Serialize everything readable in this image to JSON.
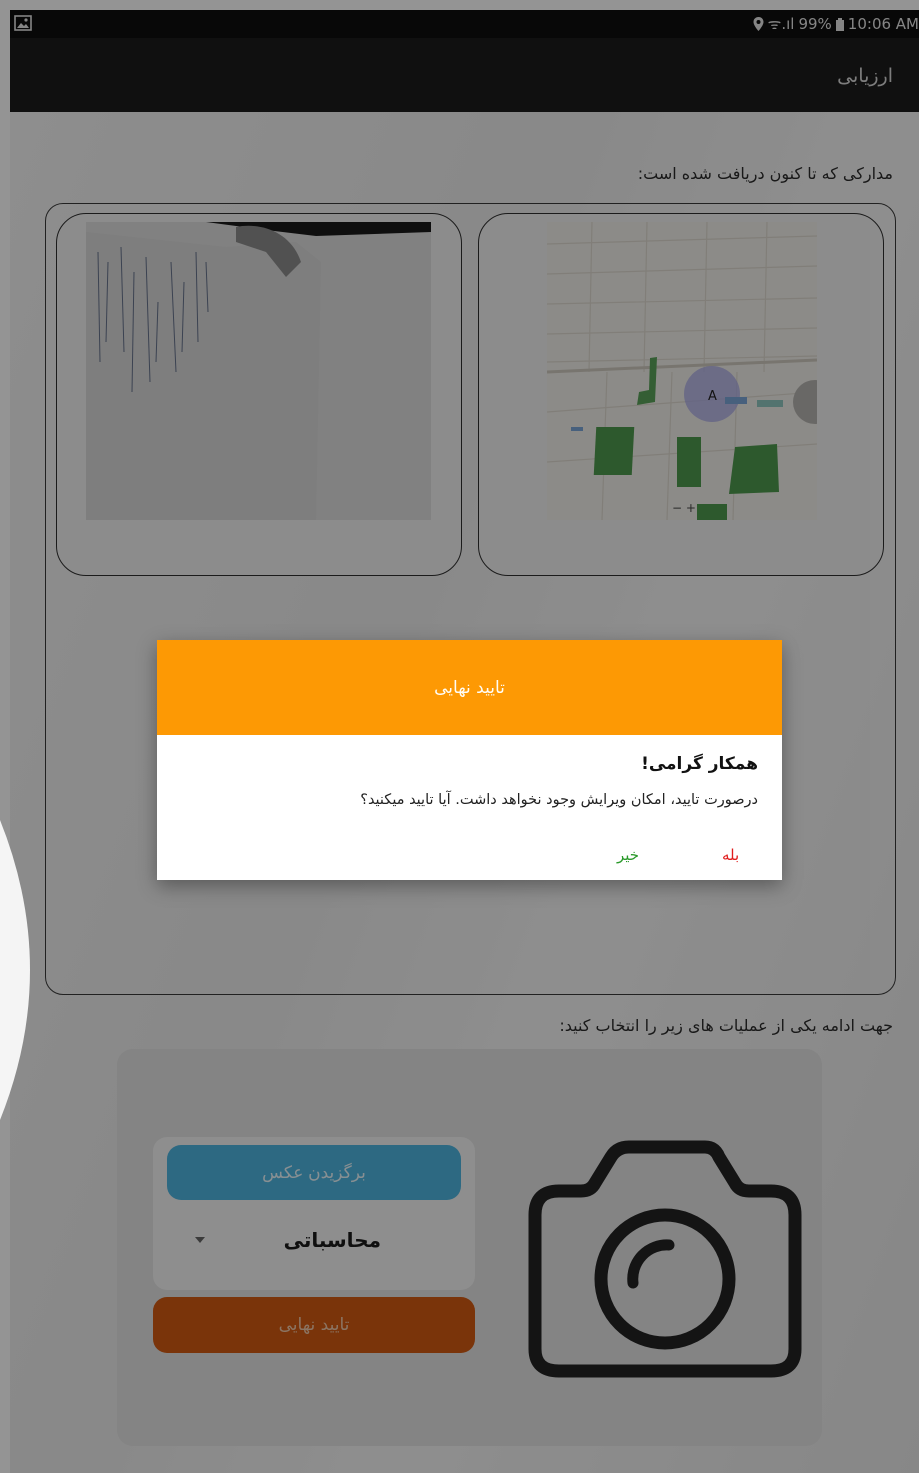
{
  "status_bar": {
    "signal": "ᯤ.ıl",
    "battery": "99%",
    "time": "10:06 AM"
  },
  "app_bar": {
    "title": "ارزیابی"
  },
  "documents": {
    "label": "مدارکی که تا کنون دریافت شده است:",
    "map_marker": "A"
  },
  "operations": {
    "label": "جهت ادامه یکی از عملیات های زیر را انتخاب کنید:",
    "choose_photo_label": "برگزیدن عکس",
    "type_select_value": "محاسباتی",
    "final_confirm_label": "تایید نهایی"
  },
  "dialog": {
    "title": "تایید نهایی",
    "heading": "همکار گرامی!",
    "message": "درصورت تایید، امکان ویرایش وجود نخواهد داشت. آیا تایید میکنید؟",
    "yes_label": "بله",
    "no_label": "خیر"
  }
}
